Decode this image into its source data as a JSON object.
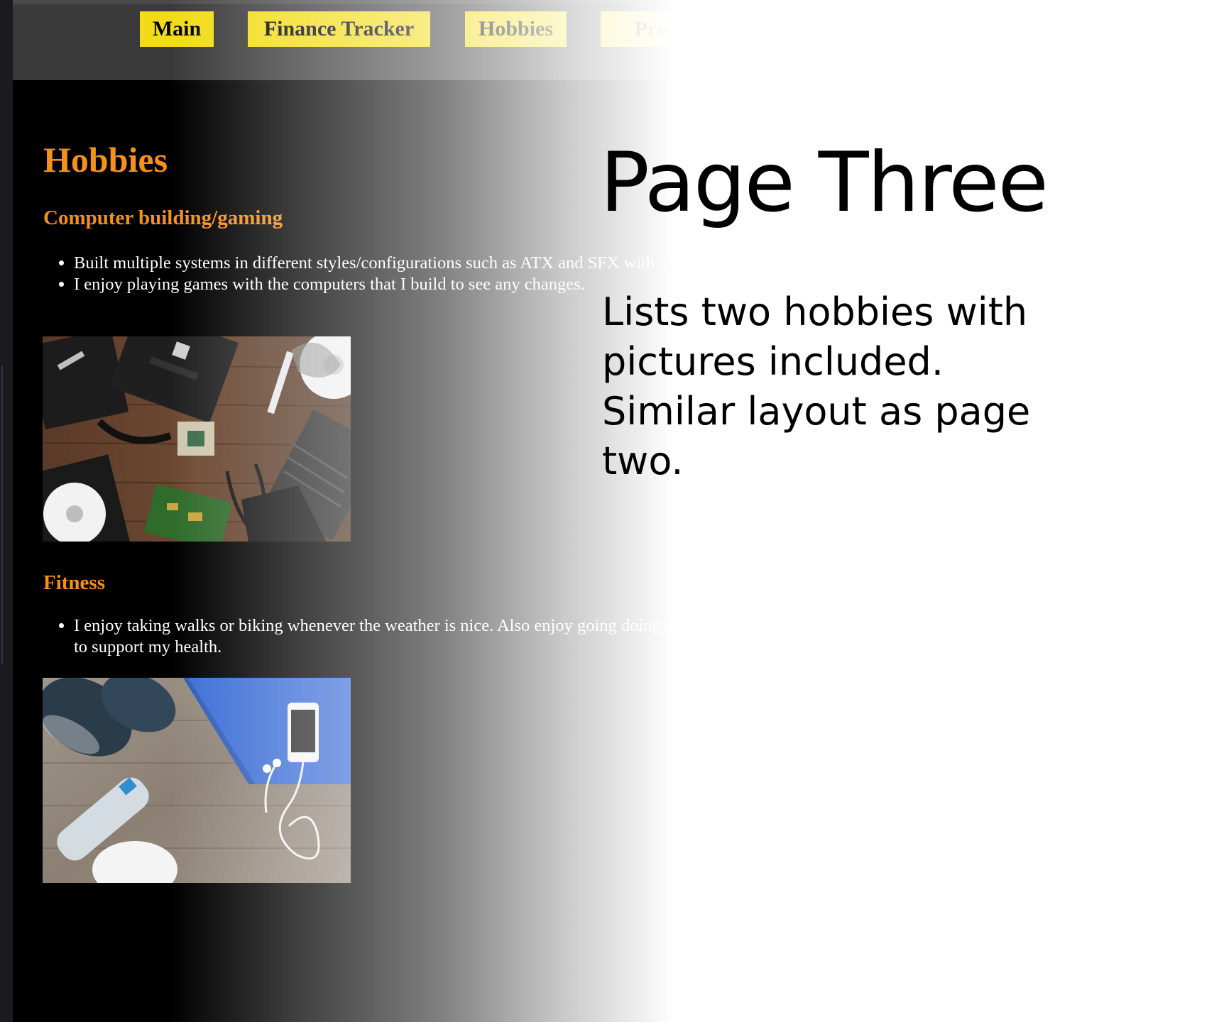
{
  "nav": {
    "items": [
      {
        "label": "Main"
      },
      {
        "label": "Finance Tracker"
      },
      {
        "label": "Hobbies"
      },
      {
        "label": "Projects"
      }
    ]
  },
  "web": {
    "heading": "Hobbies",
    "sections": [
      {
        "title": "Computer building/gaming",
        "bullets": [
          "Built multiple systems in different styles/configurations such as ATX and SFX with water cooling.",
          "I enjoy playing games with the computers that I build to see any changes."
        ],
        "image_alt": "computer parts"
      },
      {
        "title": "Fitness",
        "bullets": [
          "I enjoy taking walks or biking whenever the weather is nice. Also enjoy going doing a quick workout to support my health."
        ],
        "image_alt": "fitness gear"
      }
    ]
  },
  "slide": {
    "title": "Page Three",
    "body": "Lists two hobbies with pictures included. Similar layout as page two."
  },
  "colors": {
    "nav_button": "#f2dc15",
    "heading": "#f5901a",
    "page_bg": "#000000",
    "navbar_bg": "#3a3a3a"
  }
}
